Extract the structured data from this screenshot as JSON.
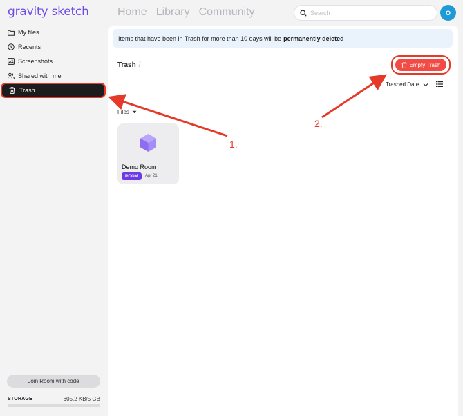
{
  "app": {
    "logo": "gravity sketch"
  },
  "topnav": [
    {
      "label": "Home"
    },
    {
      "label": "Library"
    },
    {
      "label": "Community"
    }
  ],
  "search": {
    "placeholder": "Search",
    "icon": "search-icon"
  },
  "user": {
    "avatar_initial": "O",
    "avatar_color": "#1e9ad6"
  },
  "sidebar": {
    "items": [
      {
        "label": "My files",
        "icon": "folder-icon"
      },
      {
        "label": "Recents",
        "icon": "clock-icon"
      },
      {
        "label": "Screenshots",
        "icon": "image-icon"
      },
      {
        "label": "Shared with me",
        "icon": "people-icon"
      },
      {
        "label": "Trash",
        "icon": "trash-icon",
        "active": true
      }
    ],
    "join_button": "Join Room with code",
    "storage": {
      "label": "STORAGE",
      "value": "605.2 KB/5 GB",
      "used_fraction": 0.0001
    }
  },
  "main": {
    "notice": {
      "text": "Items that have been in Trash for more than 10 days will be",
      "emphasis": "permanently deleted"
    },
    "breadcrumb": {
      "current": "Trash",
      "separator": "/"
    },
    "empty_trash_button": "Empty Trash",
    "sort": {
      "label": "Trashed Date"
    },
    "files_label": "Files",
    "files": [
      {
        "title": "Demo Room",
        "badge": "ROOM",
        "date": "Apr 21",
        "icon": "cube-icon"
      }
    ]
  },
  "annotations": {
    "step1": "1.",
    "step2": "2.",
    "color": "#e53a2a"
  },
  "colors": {
    "accent": "#6e4be6",
    "danger": "#f24b45",
    "badge": "#6c3be6"
  }
}
